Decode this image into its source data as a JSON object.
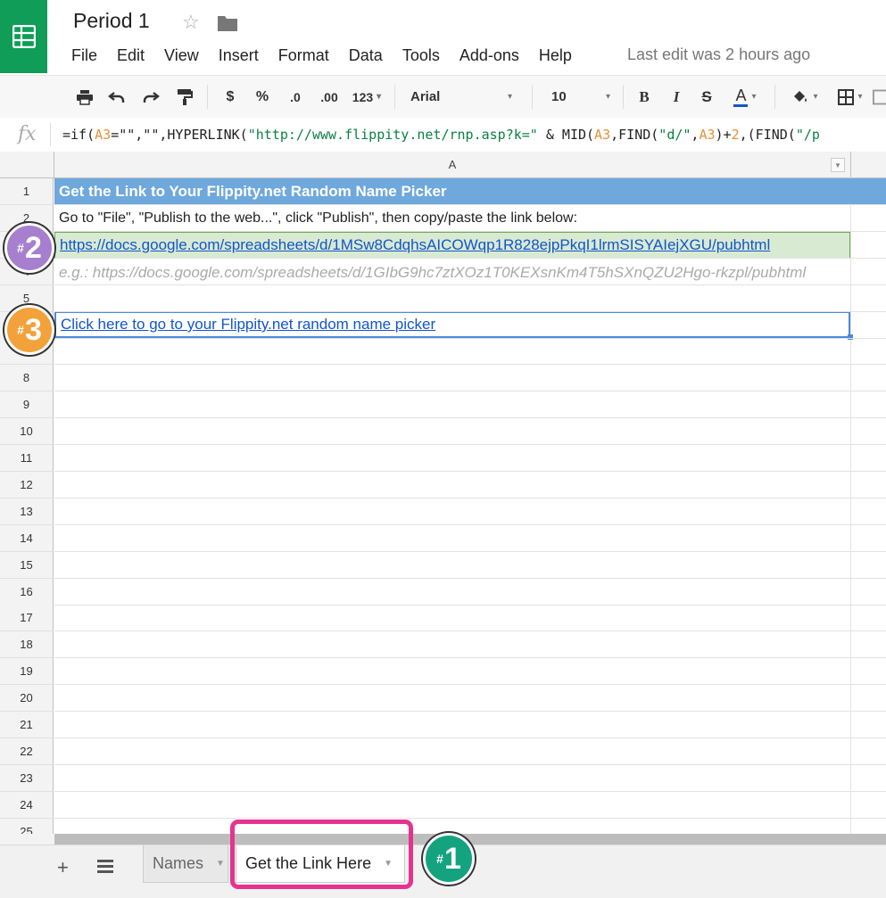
{
  "header": {
    "title": "Period 1",
    "menu": [
      "File",
      "Edit",
      "View",
      "Insert",
      "Format",
      "Data",
      "Tools",
      "Add-ons",
      "Help"
    ],
    "last_edit": "Last edit was 2 hours ago"
  },
  "toolbar": {
    "currency": "$",
    "percent": "%",
    "decrease_decimal": ".0",
    "increase_decimal": ".00",
    "more_formats": "123",
    "font": "Arial",
    "font_size": "10",
    "bold": "B",
    "italic": "I",
    "strike": "S",
    "text_color": "A"
  },
  "formula": {
    "fx": "fx",
    "parts": [
      "=if(",
      "A3",
      "=\"\",\"\",HYPERLINK(",
      "\"http://www.flippity.net/rnp.asp?k=\"",
      " & MID(",
      "A3",
      ",FIND(",
      "\"d/\"",
      ",",
      "A3",
      ")+",
      "2",
      ",(FIND(",
      "\"/p"
    ]
  },
  "grid": {
    "column": "A",
    "rows": [
      "1",
      "2",
      "3",
      "4",
      "5",
      "6",
      "7",
      "8",
      "9",
      "10",
      "11",
      "12",
      "13",
      "14",
      "15",
      "16",
      "17",
      "18",
      "19",
      "20",
      "21",
      "22",
      "23",
      "24",
      "25"
    ],
    "cells": {
      "a1": "Get the Link to Your Flippity.net Random Name Picker",
      "a2": "Go to \"File\", \"Publish to the web...\", click \"Publish\", then copy/paste the link below:",
      "a3": "https://docs.google.com/spreadsheets/d/1MSw8CdqhsAICOWqp1R828ejpPkqI1lrmSISYAIejXGU/pubhtml",
      "a4": "e.g.: https://docs.google.com/spreadsheets/d/1GIbG9hc7ztXOz1T0KEXsnKm4T5hSXnQZU2Hgo-rkzpl/pubhtml",
      "a6": "Click here to go to your Flippity.net random name picker"
    }
  },
  "callouts": {
    "one": {
      "hash": "#",
      "num": "1"
    },
    "two": {
      "hash": "#",
      "num": "2"
    },
    "three": {
      "hash": "#",
      "num": "3"
    }
  },
  "sheets": {
    "add": "+",
    "tabs": [
      "Names",
      "Get the Link Here"
    ]
  },
  "colors": {
    "logo": "#0f9d58",
    "title_row": "#6fa8dc",
    "link": "#1155cc",
    "highlight": "#e6338f",
    "badge_one": "#14a37f",
    "badge_two": "#a77fcf",
    "badge_three": "#f3a23b"
  },
  "icons": [
    "sheets-logo-icon",
    "star-icon",
    "folder-icon",
    "print-icon",
    "undo-icon",
    "redo-icon",
    "paint-format-icon",
    "fill-color-icon",
    "borders-icon",
    "merge-icon",
    "sheet-list-icon"
  ]
}
